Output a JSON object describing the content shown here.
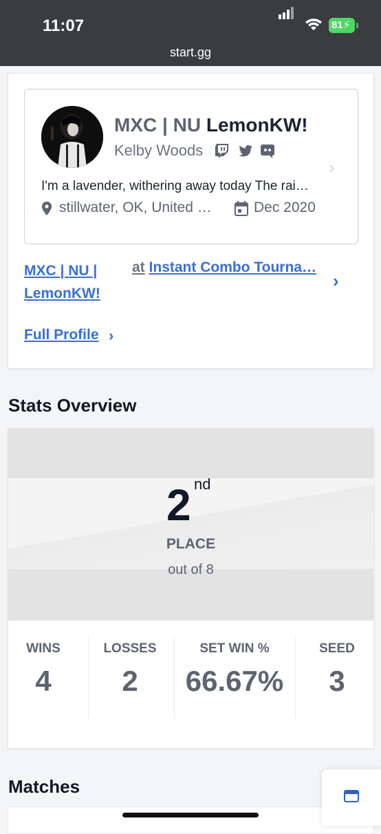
{
  "status_bar": {
    "time": "11:07",
    "battery": "81",
    "url": "start.gg"
  },
  "profile": {
    "prefix": "MXC | NU",
    "gamertag": "LemonKW!",
    "real_name": "Kelby Woods",
    "social_icons": [
      "twitch-icon",
      "twitter-icon",
      "discord-icon"
    ],
    "bio": "I'm a lavender, withering away today The rai…",
    "location": "stillwater, OK, United …",
    "joined": "Dec 2020"
  },
  "entrant": {
    "name_line1": "MXC | NU |",
    "name_line2": "LemonKW!",
    "at": "at",
    "tournament": "Instant Combo Tourna…"
  },
  "full_profile_label": "Full Profile",
  "stats_overview": {
    "title": "Stats Overview",
    "place_number": "2",
    "place_suffix": "nd",
    "place_label": "PLACE",
    "place_out_of": "out of 8",
    "stats": [
      {
        "label": "WINS",
        "value": "4"
      },
      {
        "label": "LOSSES",
        "value": "2"
      },
      {
        "label": "SET WIN %",
        "value": "66.67%"
      },
      {
        "label": "SEED",
        "value": "3"
      }
    ]
  },
  "matches_title": "Matches",
  "colors": {
    "link": "#3a6fd1",
    "status_bar": "#3a3d40",
    "battery": "#4cd964"
  }
}
